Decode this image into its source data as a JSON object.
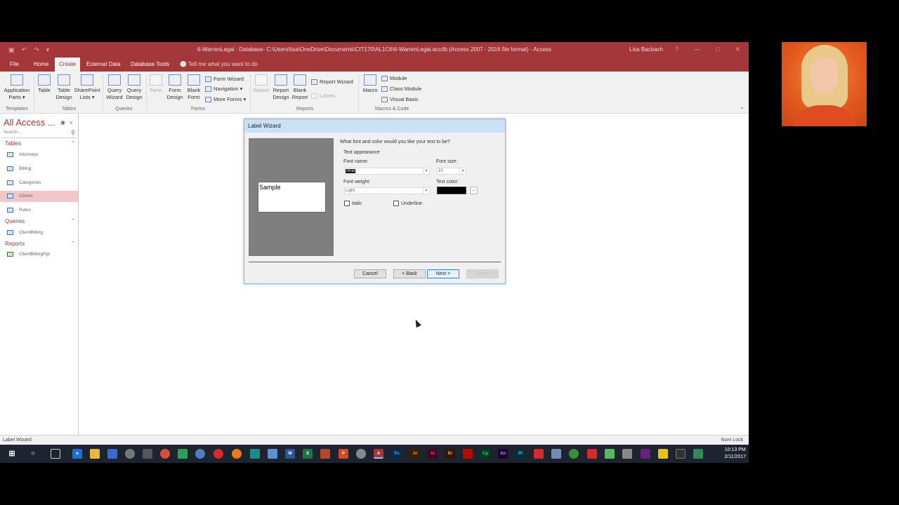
{
  "titlebar": {
    "qat": [
      "▣",
      "↶",
      "↷",
      "▾"
    ],
    "title": "6-WarrenLegal : Database- C:\\Users\\lisa\\OneDrive\\Documents\\CIT170\\AL1C6\\6-WarrenLegal.accdb (Access 2007 - 2016 file format) - Access",
    "user": "Lisa Bacbach",
    "controls": [
      "?",
      "—",
      "□",
      "✕"
    ]
  },
  "tabs": {
    "file": "File",
    "home": "Home",
    "create": "Create",
    "external": "External Data",
    "dbtools": "Database Tools",
    "tellme": "Tell me what you want to do"
  },
  "ribbon": {
    "app_parts": "Application Parts ▾",
    "table": "Table",
    "table_design": "Table Design",
    "sharepoint": "SharePoint Lists ▾",
    "query_wizard": "Query Wizard",
    "query_design": "Query Design",
    "form": "Form",
    "form_design": "Form Design",
    "blank_form": "Blank Form",
    "form_wizard": "Form Wizard",
    "navigation": "Navigation ▾",
    "more_forms": "More Forms ▾",
    "report": "Report",
    "report_design": "Report Design",
    "blank_report": "Blank Report",
    "report_wizard": "Report Wizard",
    "labels": "Labels",
    "macro": "Macro",
    "module": "Module",
    "class_module": "Class Module",
    "visual_basic": "Visual Basic",
    "groups": {
      "templates": "Templates",
      "tables": "Tables",
      "queries": "Queries",
      "forms": "Forms",
      "reports": "Reports",
      "macros": "Macros & Code"
    }
  },
  "nav": {
    "header": "All Access ...",
    "search_placeholder": "Search...",
    "sections": {
      "tables": "Tables",
      "queries": "Queries",
      "reports": "Reports"
    },
    "tables": [
      "Attorneys",
      "Billing",
      "Categories",
      "Clients",
      "Rates"
    ],
    "queries": [
      "ClientBilling"
    ],
    "reports": [
      "ClientBillingRpt"
    ]
  },
  "dialog": {
    "title": "Label Wizard",
    "sample": "Sample",
    "question": "What font and color would you like your text to be?",
    "group": "Text appearance",
    "font_name_label": "Font name:",
    "font_name_value": "Arial",
    "font_size_label": "Font size:",
    "font_size_value": "10",
    "font_weight_label": "Font weight:",
    "font_weight_value": "Light",
    "text_color_label": "Text color:",
    "text_color_value": "#000000",
    "color_button": "...",
    "italic": "Italic",
    "underline": "Underline",
    "cancel": "Cancel",
    "back": "< Back",
    "next": "Next >",
    "finish": "Finish"
  },
  "status": {
    "left": "Label Wizard",
    "right": "Num Lock"
  },
  "taskbar": {
    "time": "10:13 PM",
    "date": "2/11/2017",
    "apps": [
      "W",
      "X",
      "P",
      "A",
      "Ps",
      "Ai",
      "Id",
      "Br",
      "Cp",
      "An",
      "Pl"
    ]
  },
  "colors": {
    "accent": "#a4373a",
    "selected_item": "#f4c6c7",
    "dialog_title": "#c9e0f7"
  }
}
